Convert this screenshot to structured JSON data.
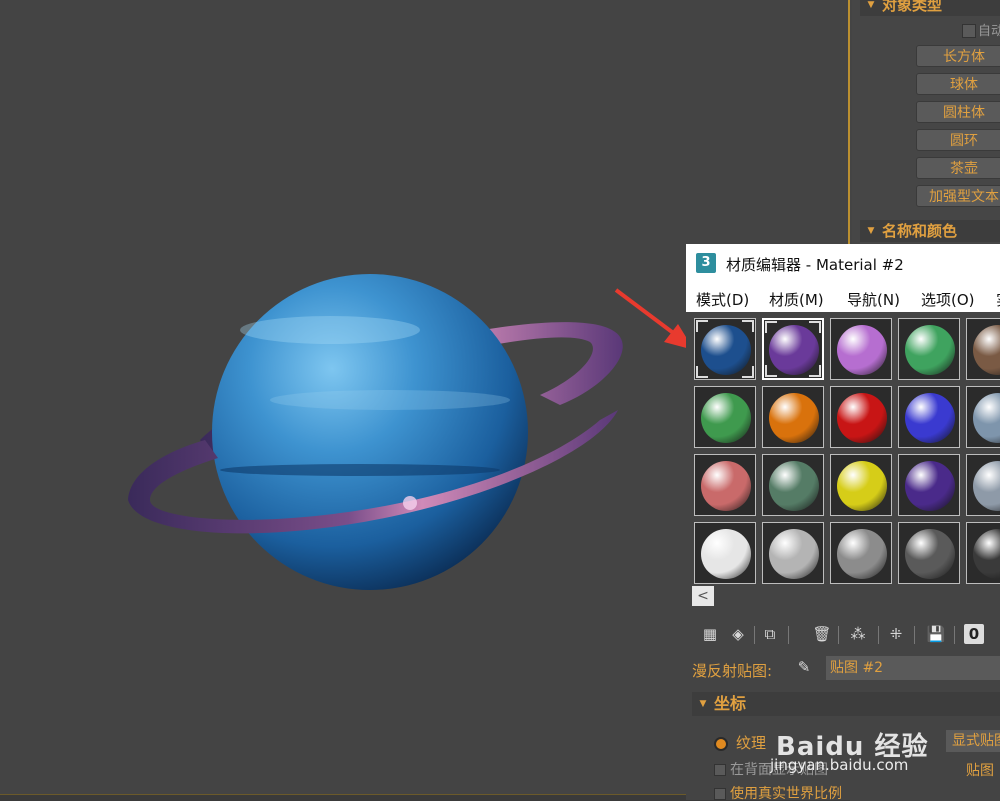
{
  "command_panel": {
    "object_type_header": "对象类型",
    "auto_grid_label": "自动",
    "buttons": [
      "长方体",
      "球体",
      "圆柱体",
      "圆环",
      "茶壶",
      "加强型文本"
    ],
    "name_color_header": "名称和颜色"
  },
  "material_editor": {
    "app_icon": "3",
    "title": "材质编辑器 - Material #2",
    "menu": [
      "模式(D)",
      "材质(M)",
      "导航(N)",
      "选项(O)",
      "实"
    ],
    "slots": [
      [
        "#1d4f8e",
        "#6a3a9a",
        "#b66ed0",
        "#3fa35f",
        "#7a5a44"
      ],
      [
        "#3f9a4e",
        "#d9720c",
        "#c81515",
        "#3a3ad0",
        "#7e95ac"
      ],
      [
        "#c96a6a",
        "#557c66",
        "#d6cd18",
        "#4a2a8a",
        "#8e9aa8"
      ],
      [
        "#e6e6e6",
        "#b4b4b4",
        "#8c8c8c",
        "#5a5a5a",
        "#3a3a3a"
      ]
    ],
    "scroll_left": "<",
    "diffuse_label": "漫反射贴图:",
    "map_name": "贴图 #2",
    "coordinates_header": "坐标",
    "texture_label": "纹理",
    "explicit_button": "显式贴图",
    "show_bg_label": "在背面显示贴图",
    "map_channel_label": "贴图",
    "real_world_label": "使用真实世界比例",
    "zero_button": "0"
  },
  "watermark": {
    "text": "Baidu 经验",
    "sub": "jingyan.baidu.com"
  },
  "colors": {
    "accent_text": "#e0a040",
    "viewport_bg": "#444444",
    "panel_border": "#bb9030",
    "annotation_arrow": "#e83a2e"
  }
}
